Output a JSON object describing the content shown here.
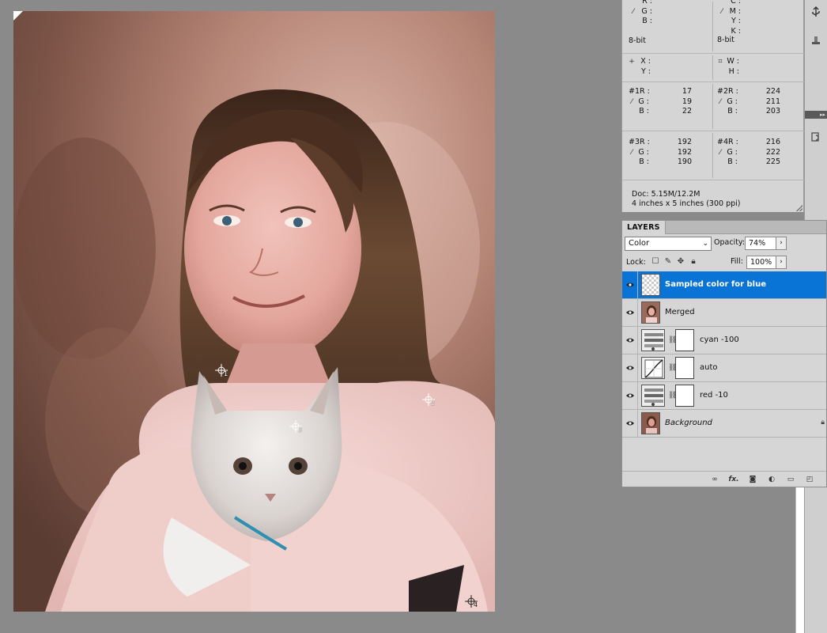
{
  "info": {
    "rgb_labels": [
      "R :",
      "G :",
      "B :"
    ],
    "cmyk_labels": [
      "C :",
      "M :",
      "Y :",
      "K :"
    ],
    "bit_depth_left": "8-bit",
    "bit_depth_right": "8-bit",
    "xy_labels": [
      "X :",
      "Y :"
    ],
    "wh_labels": [
      "W :",
      "H :"
    ],
    "samplers": [
      {
        "labels": [
          "#1R :",
          "G :",
          "B :"
        ],
        "values": [
          "17",
          "19",
          "22"
        ]
      },
      {
        "labels": [
          "#2R :",
          "G :",
          "B :"
        ],
        "values": [
          "224",
          "211",
          "203"
        ]
      },
      {
        "labels": [
          "#3R :",
          "G :",
          "B :"
        ],
        "values": [
          "192",
          "192",
          "190"
        ]
      },
      {
        "labels": [
          "#4R :",
          "G :",
          "B :"
        ],
        "values": [
          "216",
          "222",
          "225"
        ]
      }
    ],
    "doc_size": "Doc: 5.15M/12.2M",
    "doc_dimensions": "4 inches x 5 inches (300 ppi)"
  },
  "canvas": {
    "sampler_numbers": [
      "1",
      "2",
      "3",
      "4"
    ]
  },
  "layers": {
    "tab_label": "LAYERS",
    "blend_mode": "Color",
    "opacity_label": "Opacity:",
    "opacity_value": "74%",
    "lock_label": "Lock:",
    "fill_label": "Fill:",
    "fill_value": "100%",
    "items": [
      {
        "name": "Sampled color for blue",
        "selected": true
      },
      {
        "name": "Merged"
      },
      {
        "name": "cyan -100"
      },
      {
        "name": "auto"
      },
      {
        "name": "red -10"
      },
      {
        "name": "Background"
      }
    ]
  },
  "icons": {
    "eyedropper": "eyedropper-icon",
    "crosshair": "crosshair-icon",
    "visibility": "eye-icon",
    "link": "link-icon",
    "fx": "fx-icon"
  }
}
